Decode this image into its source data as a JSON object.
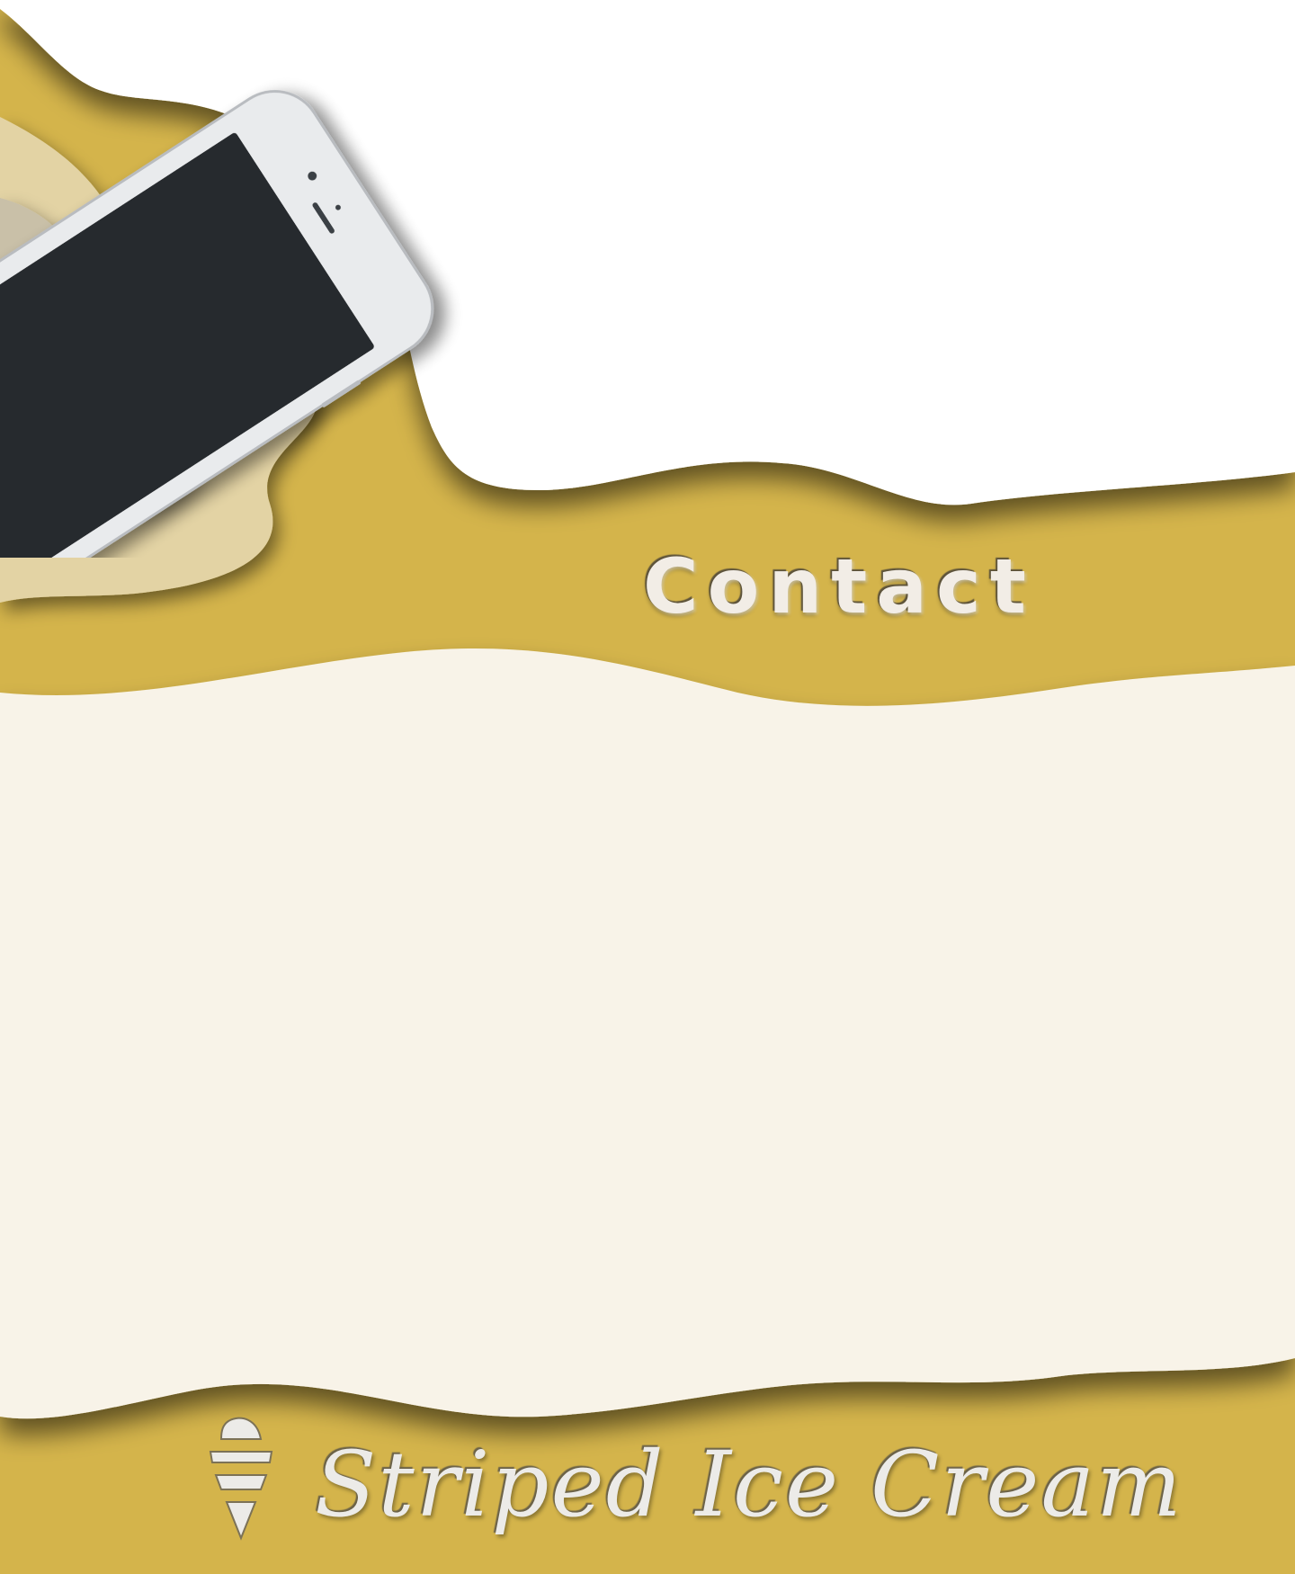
{
  "page": {
    "section_title": "Contact"
  },
  "footer": {
    "brand_name": "Striped Ice Cream",
    "logo_icon": "ice-cream-cone-icon"
  },
  "hero": {
    "device_image": "smartphone-icon"
  },
  "colors": {
    "mustard": "#d4b44b",
    "cream": "#f8f3e8",
    "white": "#ffffff",
    "phone_screen": "#262b2d",
    "phone_body": "#e9ebed"
  }
}
